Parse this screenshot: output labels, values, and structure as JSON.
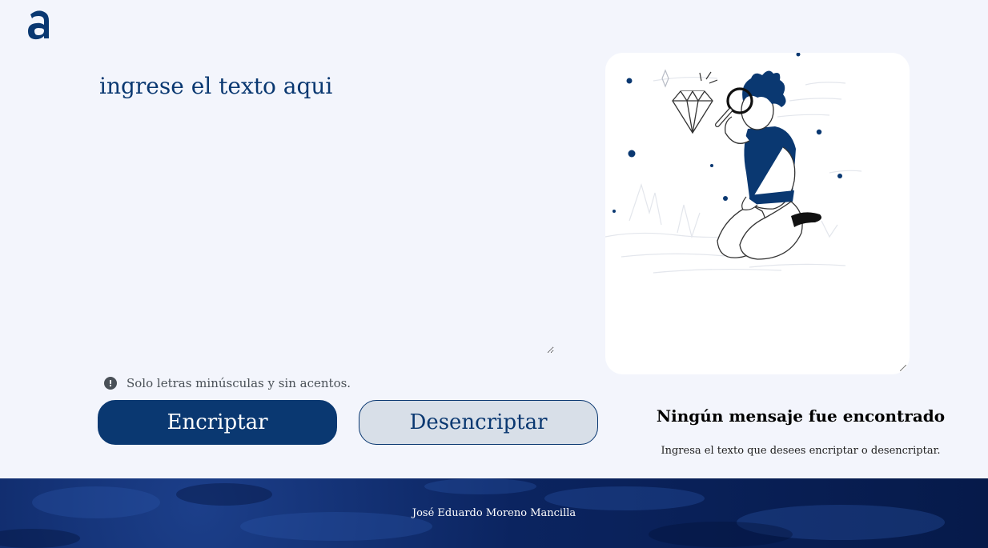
{
  "logo": {
    "icon": "alura-logo-icon",
    "color": "#0A3871"
  },
  "input": {
    "placeholder": "ingrese el texto aqui",
    "value": ""
  },
  "hint": {
    "icon": "info-icon",
    "text": "Solo letras minúsculas y sin acentos."
  },
  "buttons": {
    "encrypt_label": "Encriptar",
    "decrypt_label": "Desencriptar"
  },
  "output": {
    "illustration": "person-with-magnifying-glass-illustration",
    "title": "Ningún mensaje fue encontrado",
    "subtitle": "Ingresa el texto que desees encriptar o desencriptar."
  },
  "footer": {
    "credit": "José Eduardo Moreno Mancilla"
  },
  "colors": {
    "accent": "#0A3871",
    "background": "#F3F5FC",
    "secondary_button": "#D8DFE8"
  }
}
